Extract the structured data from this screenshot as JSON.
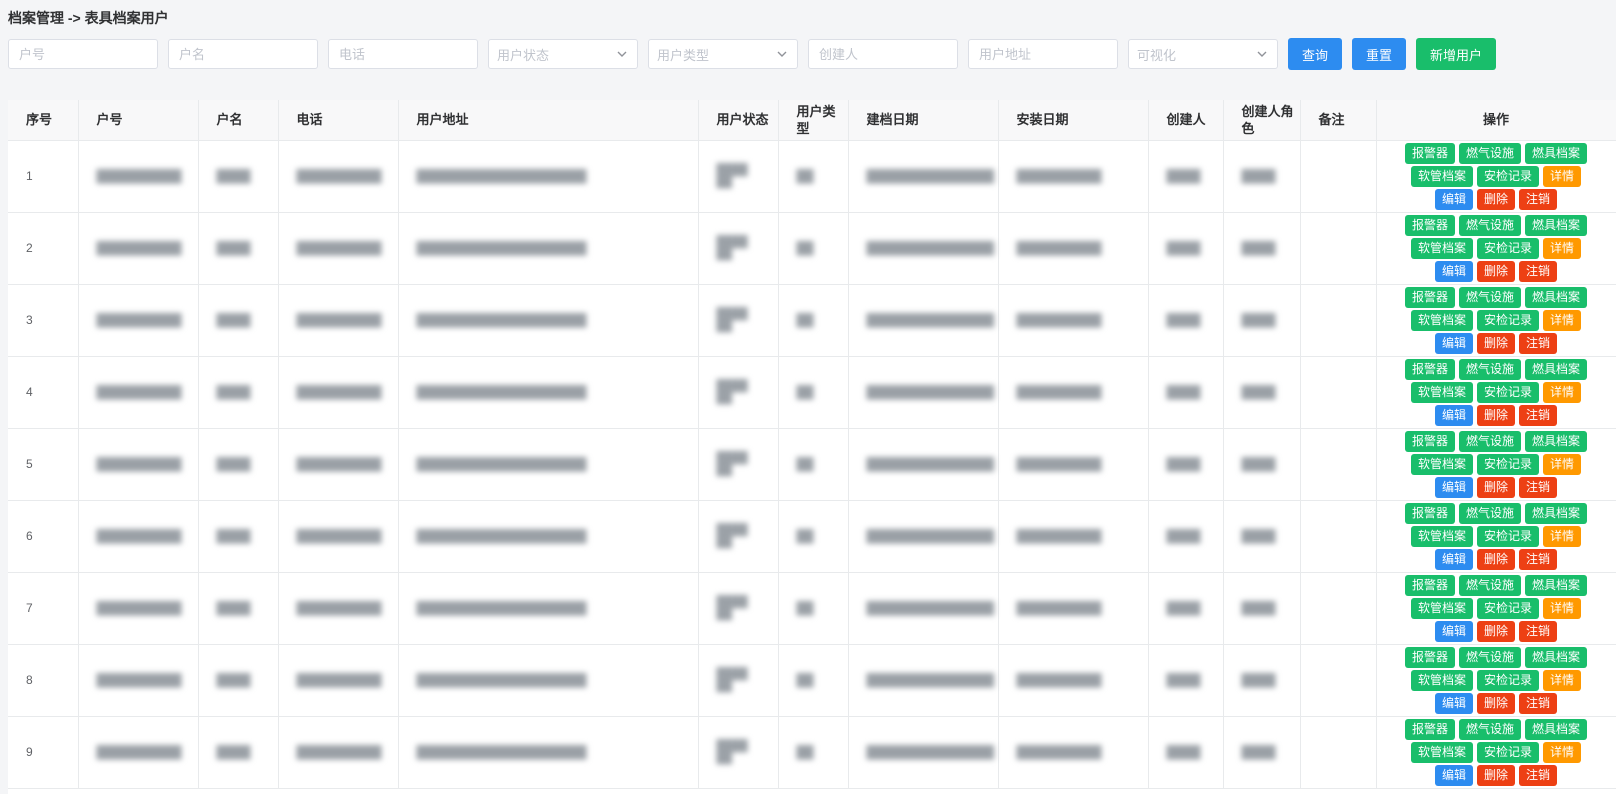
{
  "breadcrumb": "档案管理 -> 表具档案用户",
  "filters": {
    "account_no": "户号",
    "account_name": "户名",
    "phone": "电话",
    "user_status": "用户状态",
    "user_type": "用户类型",
    "creator": "创建人",
    "address": "用户地址",
    "visualization": "可视化"
  },
  "buttons": {
    "query": "查询",
    "reset": "重置",
    "add_user": "新增用户"
  },
  "columns": {
    "index": "序号",
    "account_no": "户号",
    "account_name": "户名",
    "phone": "电话",
    "address": "用户地址",
    "status": "用户状态",
    "type": "用户类型",
    "file_date": "建档日期",
    "install_date": "安装日期",
    "creator": "创建人",
    "creator_role": "创建人角色",
    "remark": "备注",
    "ops": "操作"
  },
  "actions": {
    "alarm": "报警器",
    "gas_facility": "燃气设施",
    "appliance_file": "燃具档案",
    "hose_file": "软管档案",
    "inspection_record": "安检记录",
    "details": "详情",
    "edit": "编辑",
    "delete": "删除",
    "cancel": "注销"
  },
  "rows": [
    {
      "index": "1"
    },
    {
      "index": "2"
    },
    {
      "index": "3"
    },
    {
      "index": "4"
    },
    {
      "index": "5"
    },
    {
      "index": "6"
    },
    {
      "index": "7"
    },
    {
      "index": "8"
    },
    {
      "index": "9"
    }
  ]
}
